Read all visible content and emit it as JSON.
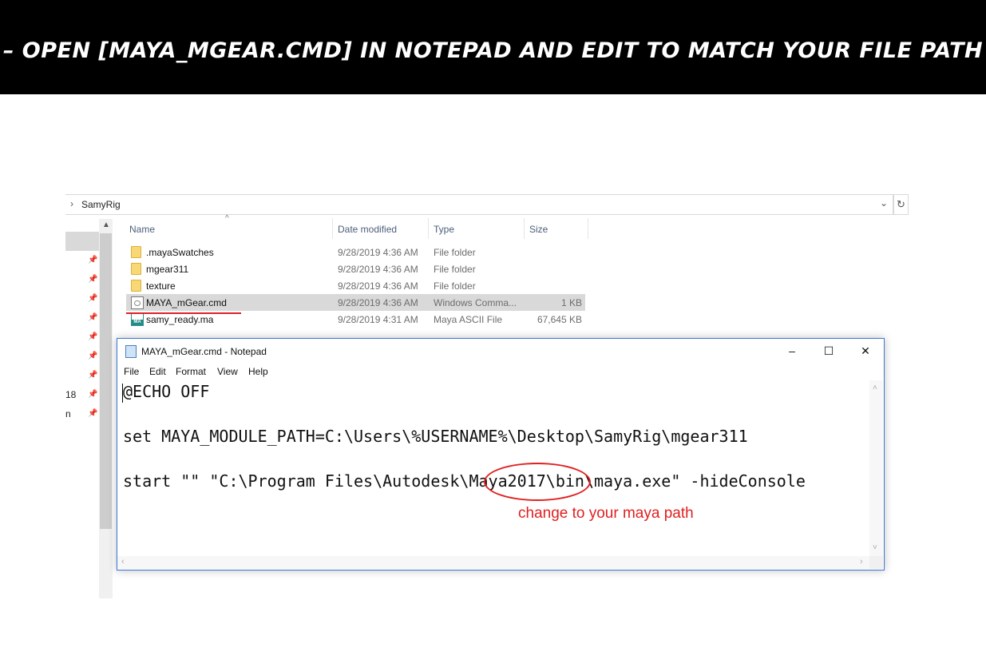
{
  "banner": {
    "text": "–  OPEN [MAYA_MGEAR.CMD] IN NOTEPAD AND EDIT TO MATCH YOUR FILE PATH"
  },
  "explorer": {
    "address": {
      "crumb": "SamyRig"
    },
    "nav_fragments": [
      "18",
      "n"
    ],
    "columns": {
      "name": "Name",
      "date": "Date modified",
      "type": "Type",
      "size": "Size"
    },
    "files": [
      {
        "name": ".mayaSwatches",
        "date": "9/28/2019 4:36 AM",
        "type": "File folder",
        "size": "",
        "icon": "folder-icon"
      },
      {
        "name": "mgear311",
        "date": "9/28/2019 4:36 AM",
        "type": "File folder",
        "size": "",
        "icon": "folder-icon"
      },
      {
        "name": "texture",
        "date": "9/28/2019 4:36 AM",
        "type": "File folder",
        "size": "",
        "icon": "folder-icon"
      },
      {
        "name": "MAYA_mGear.cmd",
        "date": "9/28/2019 4:36 AM",
        "type": "Windows Comma...",
        "size": "1 KB",
        "icon": "cmd-icon",
        "selected": true
      },
      {
        "name": "samy_ready.ma",
        "date": "9/28/2019 4:31 AM",
        "type": "Maya ASCII File",
        "size": "67,645 KB",
        "icon": "maya-ascii-icon"
      }
    ]
  },
  "notepad": {
    "title": "MAYA_mGear.cmd - Notepad",
    "controls": {
      "minimize": "–",
      "maximize": "☐",
      "close": "✕"
    },
    "menu": [
      "File",
      "Edit",
      "Format",
      "View",
      "Help"
    ],
    "lines": [
      "@ECHO OFF",
      "set MAYA_MODULE_PATH=C:\\Users\\%USERNAME%\\Desktop\\SamyRig\\mgear311",
      "start \"\" \"C:\\Program Files\\Autodesk\\Maya2017\\bin\\maya.exe\" -hideConsole"
    ]
  },
  "annotation": {
    "text": "change to your maya path",
    "color": "#e02020"
  }
}
